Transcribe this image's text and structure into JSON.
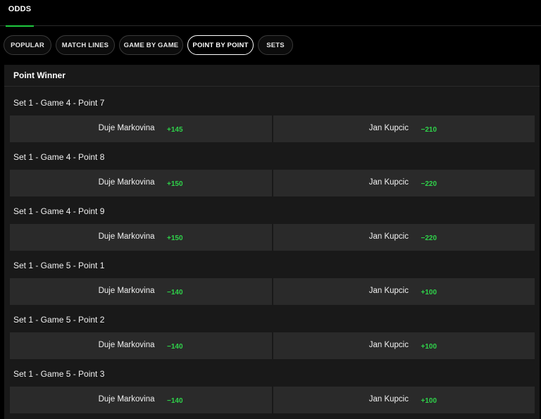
{
  "header": {
    "tab_label": "ODDS"
  },
  "filters": [
    {
      "label": "POPULAR",
      "active": false
    },
    {
      "label": "MATCH LINES",
      "active": false
    },
    {
      "label": "GAME BY GAME",
      "active": false
    },
    {
      "label": "POINT BY POINT",
      "active": true
    },
    {
      "label": "SETS",
      "active": false
    }
  ],
  "panel": {
    "title": "Point Winner"
  },
  "markets": [
    {
      "title": "Set 1 - Game 4 - Point 7",
      "home": {
        "name": "Duje Markovina",
        "price": "+145"
      },
      "away": {
        "name": "Jan Kupcic",
        "price": "−210"
      }
    },
    {
      "title": "Set 1 - Game 4 - Point 8",
      "home": {
        "name": "Duje Markovina",
        "price": "+150"
      },
      "away": {
        "name": "Jan Kupcic",
        "price": "−220"
      }
    },
    {
      "title": "Set 1 - Game 4 - Point 9",
      "home": {
        "name": "Duje Markovina",
        "price": "+150"
      },
      "away": {
        "name": "Jan Kupcic",
        "price": "−220"
      }
    },
    {
      "title": "Set 1 - Game 5 - Point 1",
      "home": {
        "name": "Duje Markovina",
        "price": "−140"
      },
      "away": {
        "name": "Jan Kupcic",
        "price": "+100"
      }
    },
    {
      "title": "Set 1 - Game 5 - Point 2",
      "home": {
        "name": "Duje Markovina",
        "price": "−140"
      },
      "away": {
        "name": "Jan Kupcic",
        "price": "+100"
      }
    },
    {
      "title": "Set 1 - Game 5 - Point 3",
      "home": {
        "name": "Duje Markovina",
        "price": "−140"
      },
      "away": {
        "name": "Jan Kupcic",
        "price": "+100"
      }
    }
  ],
  "colors": {
    "accent": "#1fc93f",
    "price": "#2fd24a",
    "panel": "#191919",
    "button": "#2a2a2a"
  }
}
